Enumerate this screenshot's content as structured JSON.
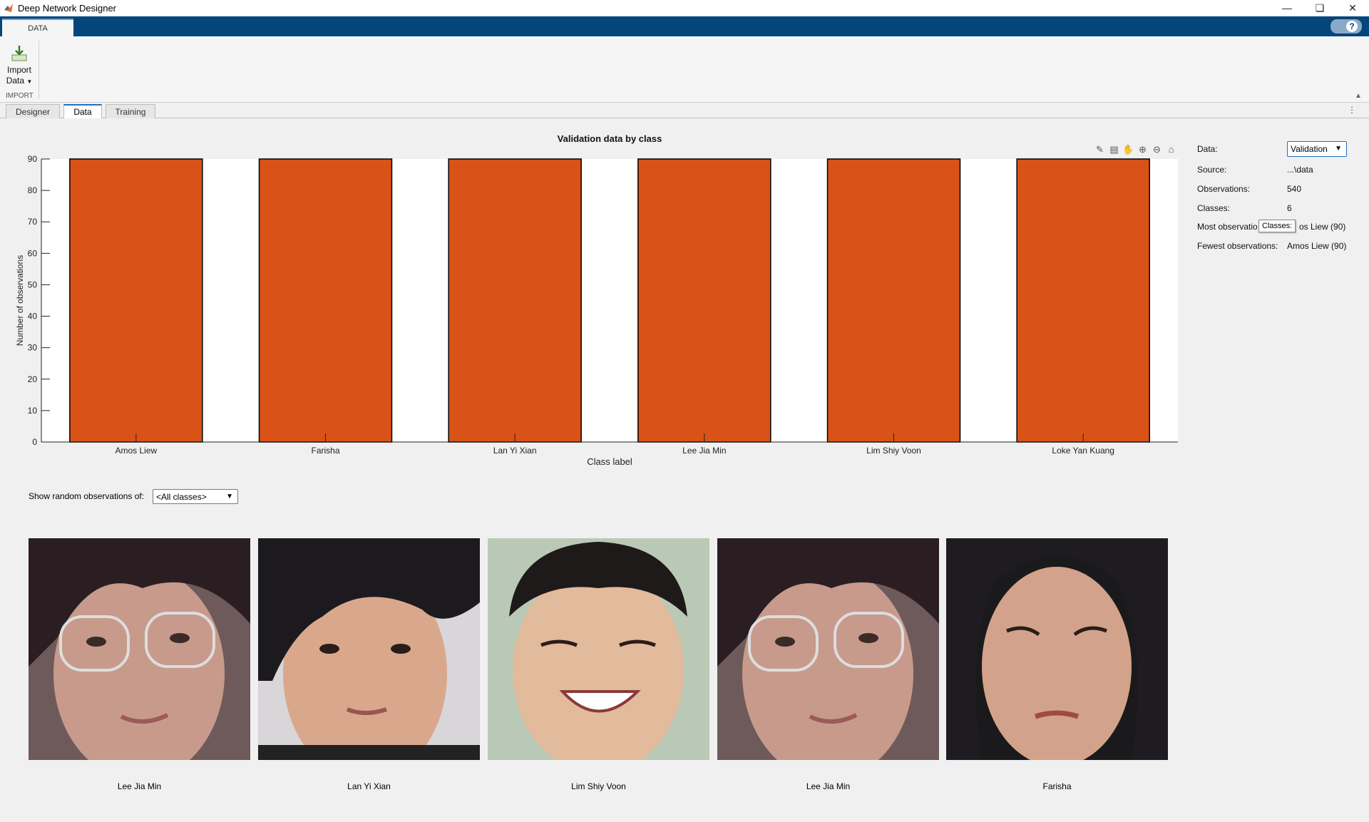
{
  "window": {
    "title": "Deep Network Designer",
    "controls": [
      "minimize-icon",
      "restore-icon",
      "close-icon"
    ]
  },
  "ribbon": {
    "tab": "DATA",
    "help_icon": "?",
    "import_button": {
      "line1": "Import",
      "line2": "Data"
    },
    "section_label": "IMPORT"
  },
  "doc_tabs": [
    "Designer",
    "Data",
    "Training"
  ],
  "active_doc_tab": "Data",
  "chart_data": {
    "type": "bar",
    "title": "Validation data by class",
    "xlabel": "Class label",
    "ylabel": "Number of observations",
    "categories": [
      "Amos Liew",
      "Farisha",
      "Lan Yi Xian",
      "Lee Jia Min",
      "Lim Shiy Voon",
      "Loke Yan Kuang"
    ],
    "values": [
      90,
      90,
      90,
      90,
      90,
      90
    ],
    "ylim": [
      0,
      90
    ],
    "yticks": [
      0,
      10,
      20,
      30,
      40,
      50,
      60,
      70,
      80,
      90
    ],
    "bar_color": "#d95319",
    "grid": false
  },
  "info": {
    "data_label": "Data:",
    "data_value": "Validation",
    "source_label": "Source:",
    "source_value": "...\\data",
    "observations_label": "Observations:",
    "observations_value": "540",
    "classes_label": "Classes:",
    "classes_value": "6",
    "most_label": "Most observatio",
    "most_value": "os Liew (90)",
    "fewest_label": "Fewest observations:",
    "fewest_value": "Amos Liew (90)",
    "tooltip": "Classes:"
  },
  "observations": {
    "show_label": "Show random observations of:",
    "class_filter": "<All classes>",
    "images": [
      {
        "label": "Lee Jia Min"
      },
      {
        "label": "Lan Yi Xian"
      },
      {
        "label": "Lim Shiy Voon"
      },
      {
        "label": "Lee Jia Min"
      },
      {
        "label": "Farisha"
      }
    ]
  }
}
